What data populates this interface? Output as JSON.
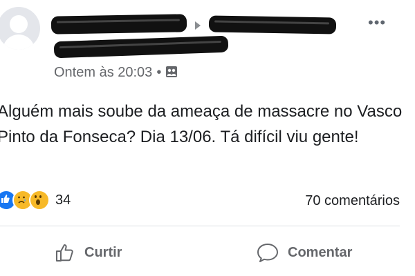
{
  "post": {
    "timestamp": "Ontem às 20:03",
    "separator": "•",
    "text": "Alguém mais soube da ameaça de massacre no Vasco Pinto da Fonseca? Dia 13/06. Tá difícil viu gente!",
    "reaction_count": "34",
    "reaction_types": [
      "like-icon",
      "sad-icon",
      "wow-icon"
    ],
    "comments_label": "70 comentários",
    "more_label": "•••"
  },
  "actions": {
    "like_label": "Curtir",
    "comment_label": "Comentar"
  },
  "colors": {
    "like_blue": "#1877f2",
    "emoji_yellow": "#f7b928",
    "secondary_text": "#65676b"
  }
}
